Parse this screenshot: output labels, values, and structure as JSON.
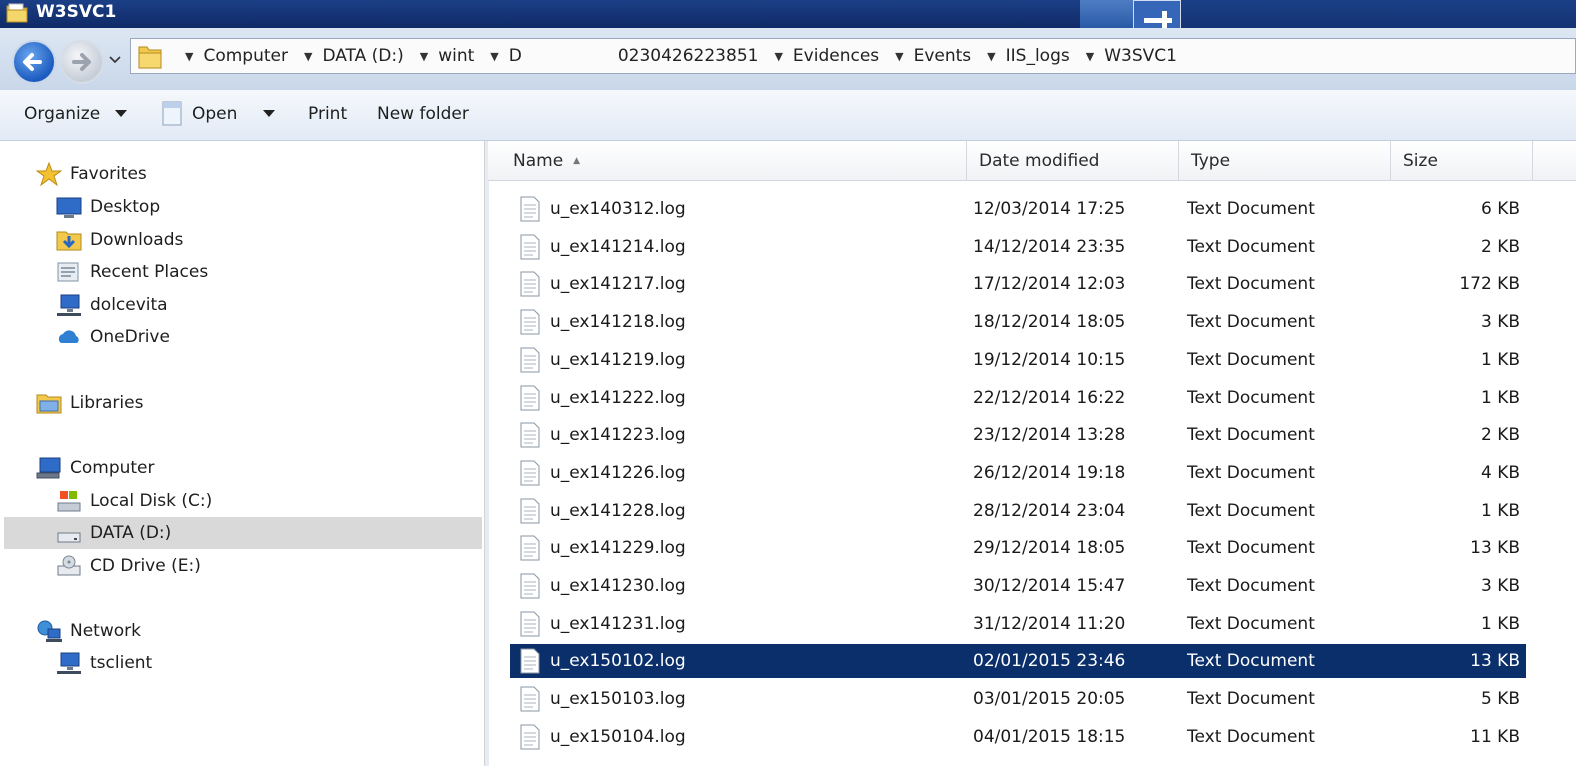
{
  "window": {
    "title": "W3SVC1"
  },
  "breadcrumb": [
    "Computer",
    "DATA (D:)",
    "wint",
    "D",
    "0230426223851",
    "Evidences",
    "Events",
    "IIS_logs",
    "W3SVC1"
  ],
  "toolbar": {
    "organize": "Organize",
    "open": "Open",
    "print": "Print",
    "new_folder": "New folder"
  },
  "sidebar": {
    "groups": [
      {
        "label": "Favorites",
        "icon": "star-icon",
        "items": [
          {
            "label": "Desktop",
            "icon": "desktop-icon"
          },
          {
            "label": "Downloads",
            "icon": "downloads-folder-icon"
          },
          {
            "label": "Recent Places",
            "icon": "recent-places-icon"
          },
          {
            "label": "dolcevita",
            "icon": "network-computer-icon"
          },
          {
            "label": "OneDrive",
            "icon": "cloud-icon"
          }
        ]
      },
      {
        "label": "Libraries",
        "icon": "libraries-icon",
        "items": []
      },
      {
        "label": "Computer",
        "icon": "computer-icon",
        "items": [
          {
            "label": "Local Disk (C:)",
            "icon": "local-disk-icon"
          },
          {
            "label": "DATA (D:)",
            "icon": "drive-icon",
            "selected": true
          },
          {
            "label": "CD Drive (E:)",
            "icon": "cd-drive-icon"
          }
        ]
      },
      {
        "label": "Network",
        "icon": "network-icon",
        "items": [
          {
            "label": "tsclient",
            "icon": "network-computer-icon"
          }
        ]
      }
    ]
  },
  "columns": {
    "name": "Name",
    "date": "Date modified",
    "type": "Type",
    "size": "Size"
  },
  "files": [
    {
      "name": "u_ex140312.log",
      "date": "12/03/2014 17:25",
      "type": "Text Document",
      "size": "6 KB"
    },
    {
      "name": "u_ex141214.log",
      "date": "14/12/2014 23:35",
      "type": "Text Document",
      "size": "2 KB"
    },
    {
      "name": "u_ex141217.log",
      "date": "17/12/2014 12:03",
      "type": "Text Document",
      "size": "172 KB"
    },
    {
      "name": "u_ex141218.log",
      "date": "18/12/2014 18:05",
      "type": "Text Document",
      "size": "3 KB"
    },
    {
      "name": "u_ex141219.log",
      "date": "19/12/2014 10:15",
      "type": "Text Document",
      "size": "1 KB"
    },
    {
      "name": "u_ex141222.log",
      "date": "22/12/2014 16:22",
      "type": "Text Document",
      "size": "1 KB"
    },
    {
      "name": "u_ex141223.log",
      "date": "23/12/2014 13:28",
      "type": "Text Document",
      "size": "2 KB"
    },
    {
      "name": "u_ex141226.log",
      "date": "26/12/2014 19:18",
      "type": "Text Document",
      "size": "4 KB"
    },
    {
      "name": "u_ex141228.log",
      "date": "28/12/2014 23:04",
      "type": "Text Document",
      "size": "1 KB"
    },
    {
      "name": "u_ex141229.log",
      "date": "29/12/2014 18:05",
      "type": "Text Document",
      "size": "13 KB"
    },
    {
      "name": "u_ex141230.log",
      "date": "30/12/2014 15:47",
      "type": "Text Document",
      "size": "3 KB"
    },
    {
      "name": "u_ex141231.log",
      "date": "31/12/2014 11:20",
      "type": "Text Document",
      "size": "1 KB"
    },
    {
      "name": "u_ex150102.log",
      "date": "02/01/2015 23:46",
      "type": "Text Document",
      "size": "13 KB",
      "selected": true
    },
    {
      "name": "u_ex150103.log",
      "date": "03/01/2015 20:05",
      "type": "Text Document",
      "size": "5 KB"
    },
    {
      "name": "u_ex150104.log",
      "date": "04/01/2015 18:15",
      "type": "Text Document",
      "size": "11 KB"
    }
  ],
  "colors": {
    "selection": "#0b2f6b",
    "titlebar": "#102a66"
  }
}
